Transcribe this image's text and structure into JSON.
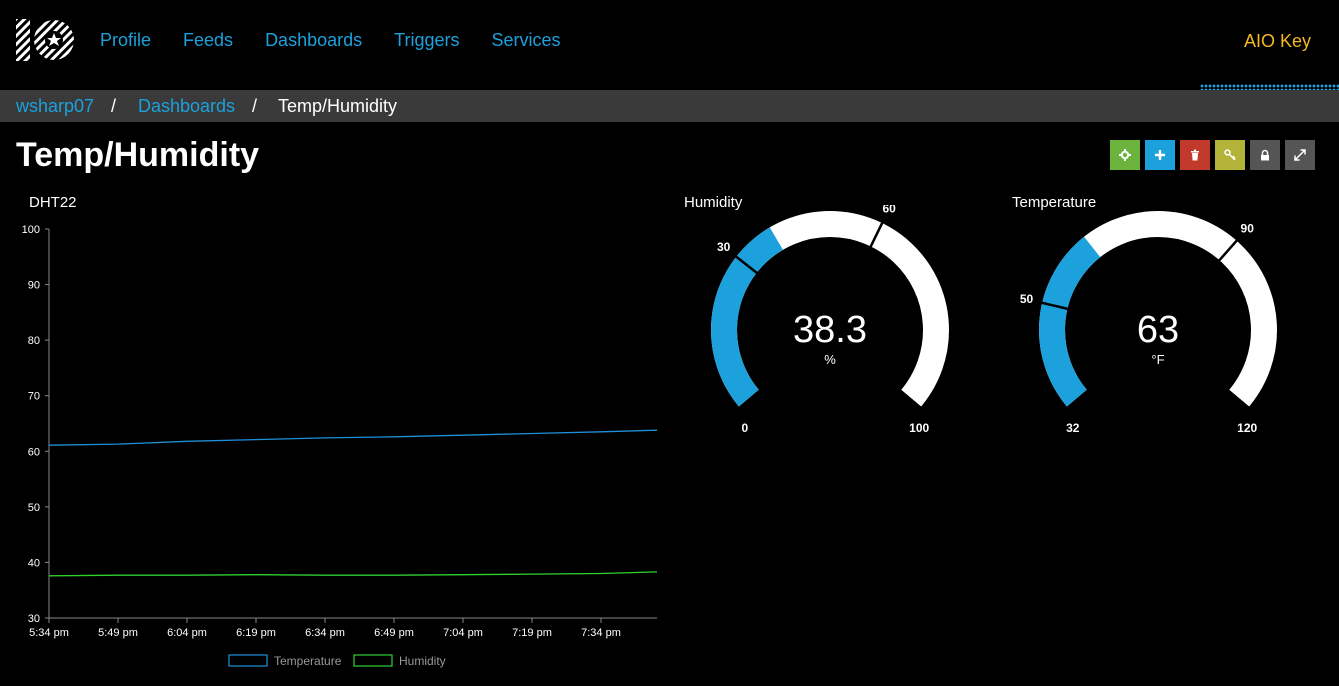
{
  "nav": {
    "items": [
      "Profile",
      "Feeds",
      "Dashboards",
      "Triggers",
      "Services"
    ],
    "aio_key": "AIO Key"
  },
  "breadcrumb": {
    "user": "wsharp07",
    "section": "Dashboards",
    "current": "Temp/Humidity",
    "separator": "/"
  },
  "page": {
    "title": "Temp/Humidity"
  },
  "toolbar": [
    {
      "name": "settings-button",
      "icon": "gear-icon",
      "color": "#6cb33e"
    },
    {
      "name": "add-block-button",
      "icon": "plus-icon",
      "color": "#1ca1dc"
    },
    {
      "name": "delete-button",
      "icon": "trash-icon",
      "color": "#c0392b"
    },
    {
      "name": "key-button",
      "icon": "key-icon",
      "color": "#b3b33a"
    },
    {
      "name": "lock-button",
      "icon": "lock-icon",
      "color": "#555555"
    },
    {
      "name": "fullscreen-button",
      "icon": "expand-icon",
      "color": "#555555"
    }
  ],
  "colors": {
    "accent": "#1ca1dc",
    "aio_key": "#f5b821",
    "temperature": "#1e90d8",
    "humidity": "#2fd12f",
    "gauge_track": "#ffffff"
  },
  "chart_data": [
    {
      "type": "line",
      "title": "DHT22",
      "ylim": [
        30,
        100
      ],
      "yticks": [
        30,
        40,
        50,
        60,
        70,
        80,
        90,
        100
      ],
      "xticks": [
        "5:34 pm",
        "5:49 pm",
        "6:04 pm",
        "6:19 pm",
        "6:34 pm",
        "6:49 pm",
        "7:04 pm",
        "7:19 pm",
        "7:34 pm"
      ],
      "legend_position": "bottom",
      "grid": false,
      "series": [
        {
          "name": "Temperature",
          "color": "#1e90d8",
          "x": [
            "5:34 pm",
            "5:49 pm",
            "6:04 pm",
            "6:19 pm",
            "6:34 pm",
            "6:49 pm",
            "7:04 pm",
            "7:19 pm",
            "7:34 pm",
            "7:44 pm"
          ],
          "values": [
            61.1,
            61.3,
            61.8,
            62.1,
            62.4,
            62.6,
            62.9,
            63.2,
            63.5,
            63.8
          ]
        },
        {
          "name": "Humidity",
          "color": "#2fd12f",
          "x": [
            "5:34 pm",
            "5:49 pm",
            "6:04 pm",
            "6:19 pm",
            "6:34 pm",
            "6:49 pm",
            "7:04 pm",
            "7:19 pm",
            "7:34 pm",
            "7:44 pm"
          ],
          "values": [
            37.6,
            37.7,
            37.7,
            37.8,
            37.7,
            37.7,
            37.8,
            37.9,
            38.0,
            38.3
          ]
        }
      ]
    },
    {
      "type": "gauge",
      "title": "Humidity",
      "value": 38.3,
      "value_label": "38.3",
      "unit": "%",
      "min": 0,
      "max": 100,
      "low": 30,
      "high": 60,
      "labels": {
        "min": "0",
        "max": "100",
        "low": "30",
        "high": "60"
      },
      "color": "#1ca1dc"
    },
    {
      "type": "gauge",
      "title": "Temperature",
      "value": 63,
      "value_label": "63",
      "unit": "°F",
      "min": 32,
      "max": 120,
      "low": 50,
      "high": 90,
      "labels": {
        "min": "32",
        "max": "120",
        "low": "50",
        "high": "90"
      },
      "color": "#1ca1dc"
    }
  ]
}
